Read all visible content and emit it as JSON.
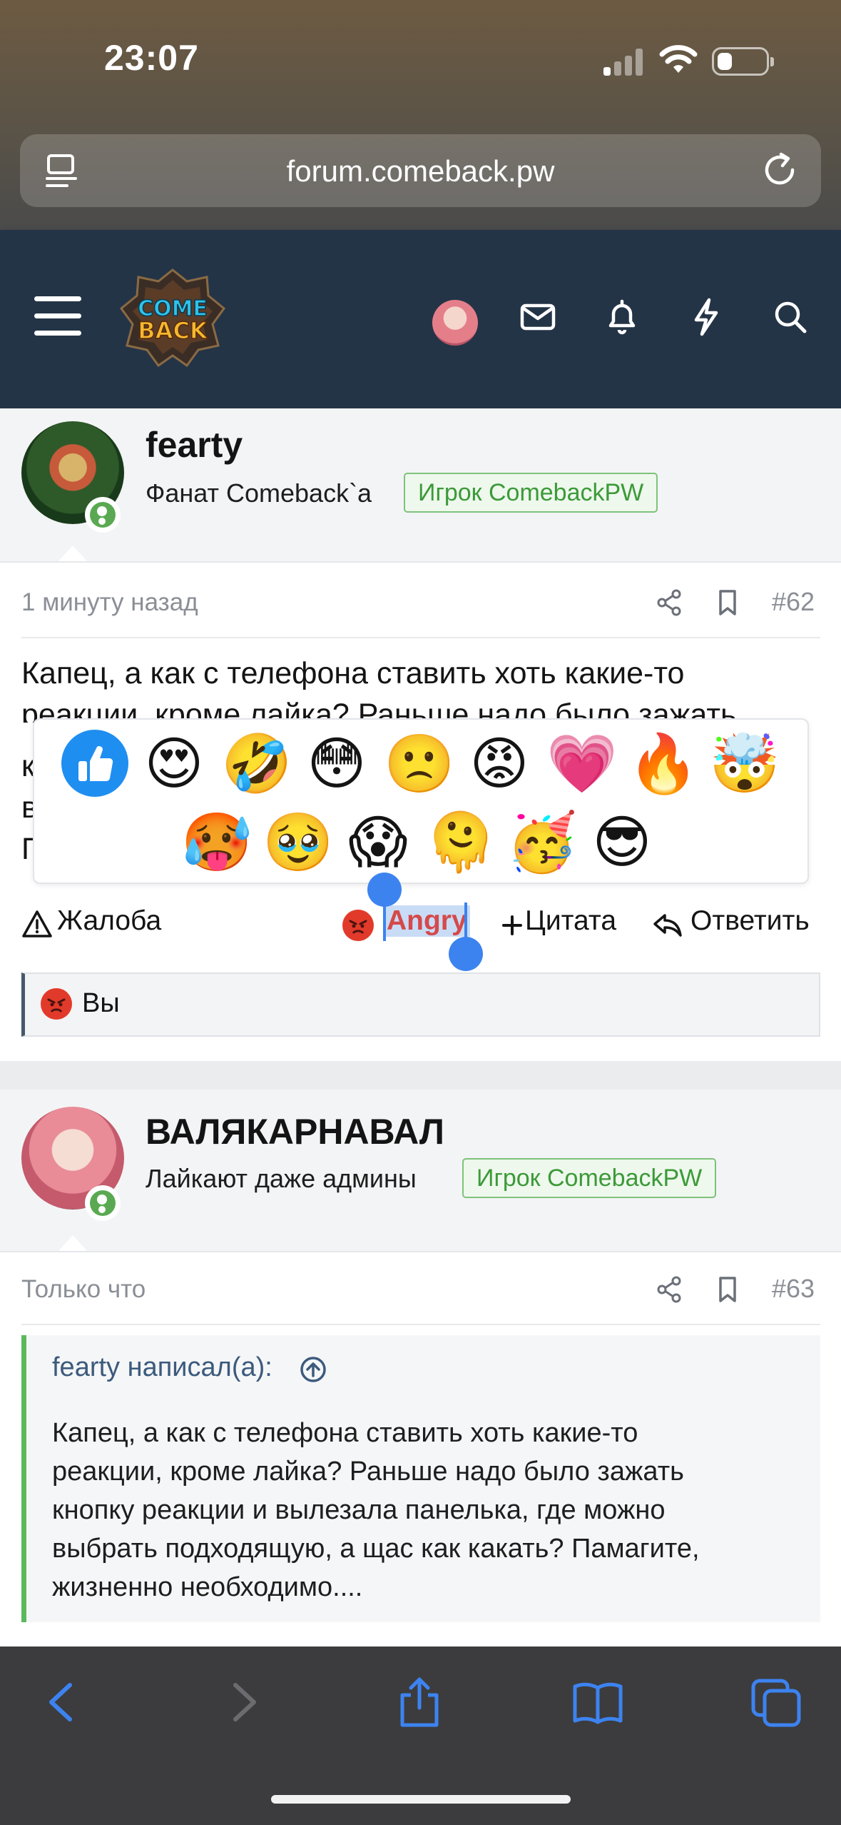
{
  "status_bar": {
    "time": "23:07"
  },
  "browser": {
    "url": "forum.comeback.pw"
  },
  "header": {
    "logo_text": "COME BACK"
  },
  "posts": [
    {
      "username": "fearty",
      "user_title": "Фанат Comeback`a",
      "badge": "Игрок ComebackPW",
      "time": "1 минуту назад",
      "number": "#62",
      "message_line1": "Капец, а как с телефона ставить хоть какие-то",
      "message_line2": "реакции, кроме лайка? Раньше надо было зажать",
      "message_left_chars": [
        "к",
        "в",
        "П"
      ],
      "actions": {
        "report": "Жалоба",
        "reaction": "Angry",
        "quote": "Цитата",
        "reply": "Ответить"
      },
      "reactions_summary": "Вы"
    },
    {
      "username": "ВАЛЯКАРНАВАЛ",
      "user_title": "Лайкают даже админы",
      "badge": "Игрок ComebackPW",
      "time": "Только что",
      "number": "#63",
      "quote_header": "fearty написал(а):",
      "quote_lines": [
        "Капец, а как с телефона ставить хоть какие-то",
        "реакции, кроме лайка? Раньше надо было зажать",
        "кнопку реакции и вылезала панелька, где можно",
        "выбрать подходящую, а щас как какать? Памагите,",
        "жизненно необходимо...."
      ]
    }
  ],
  "reaction_picker": {
    "row1": [
      "like",
      "😍",
      "🤣",
      "😳",
      "🙁",
      "😡",
      "💗",
      "🔥",
      "🤯"
    ],
    "row2": [
      "🥵",
      "🥹",
      "😱",
      "🫠",
      "🥳",
      "😎"
    ]
  },
  "colors": {
    "header_bg": "#243447",
    "badge_green": "#3c9a38",
    "online_green": "#5aa952",
    "quote_border": "#5cb85c",
    "selection_blue": "#3d83f0"
  }
}
